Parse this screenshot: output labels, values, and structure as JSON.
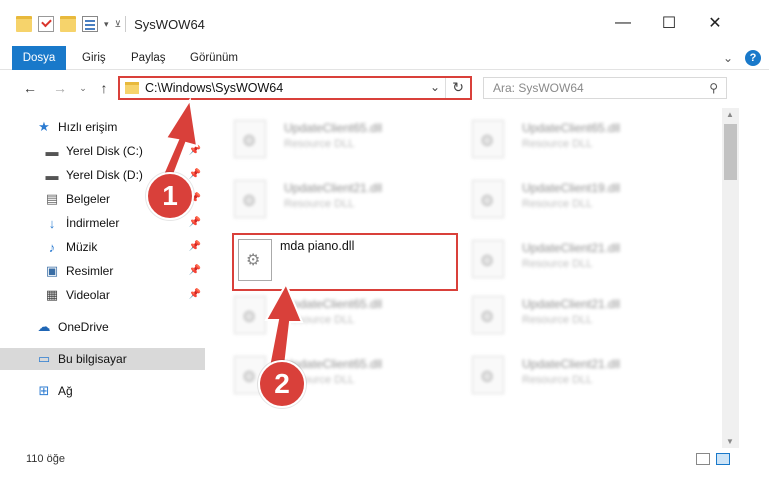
{
  "window": {
    "title": "SysWOW64",
    "minimize": "—",
    "maximize": "☐",
    "close": "✕"
  },
  "ribbon": {
    "tabs": [
      "Dosya",
      "Giriş",
      "Paylaş",
      "Görünüm"
    ],
    "expand": "⌄",
    "help": "?"
  },
  "address": {
    "path": "C:\\Windows\\SysWOW64",
    "search_placeholder": "Ara: SysWOW64"
  },
  "sidebar": {
    "items": [
      {
        "label": "Hızlı erişim",
        "icon": "star-icon"
      },
      {
        "label": "Yerel Disk (C:)",
        "icon": "drive-icon",
        "pinned": true
      },
      {
        "label": "Yerel Disk (D:)",
        "icon": "drive-icon",
        "pinned": true
      },
      {
        "label": "Belgeler",
        "icon": "documents-icon",
        "pinned": true
      },
      {
        "label": "İndirmeler",
        "icon": "download-icon",
        "pinned": true
      },
      {
        "label": "Müzik",
        "icon": "music-icon",
        "pinned": true
      },
      {
        "label": "Resimler",
        "icon": "pictures-icon",
        "pinned": true
      },
      {
        "label": "Videolar",
        "icon": "video-icon",
        "pinned": true
      },
      {
        "label": "OneDrive",
        "icon": "cloud-icon"
      },
      {
        "label": "Bu bilgisayar",
        "icon": "computer-icon",
        "selected": true
      },
      {
        "label": "Ağ",
        "icon": "network-icon"
      }
    ]
  },
  "files": [
    {
      "name": "UpdateClient65.dll",
      "type": "Resource DLL"
    },
    {
      "name": "UpdateClient65.dll",
      "type": "Resource DLL"
    },
    {
      "name": "UpdateClient21.dll",
      "type": "Resource DLL"
    },
    {
      "name": "UpdateClient19.dll",
      "type": "Resource DLL"
    },
    {
      "name": "UpdateClient21.dll",
      "type": "Resource DLL"
    },
    {
      "name": "UpdateClient65.dll",
      "type": "Resource DLL"
    },
    {
      "name": "UpdateClient21.dll",
      "type": "Resource DLL"
    },
    {
      "name": "UpdateClient65.dll",
      "type": "Resource DLL"
    },
    {
      "name": "UpdateClient21.dll",
      "type": "Resource DLL"
    }
  ],
  "highlighted_file": {
    "name": "mda piano.dll"
  },
  "status": {
    "count": "110 öğe"
  },
  "annotations": {
    "step1": "1",
    "step2": "2",
    "color": "#d9403a"
  }
}
